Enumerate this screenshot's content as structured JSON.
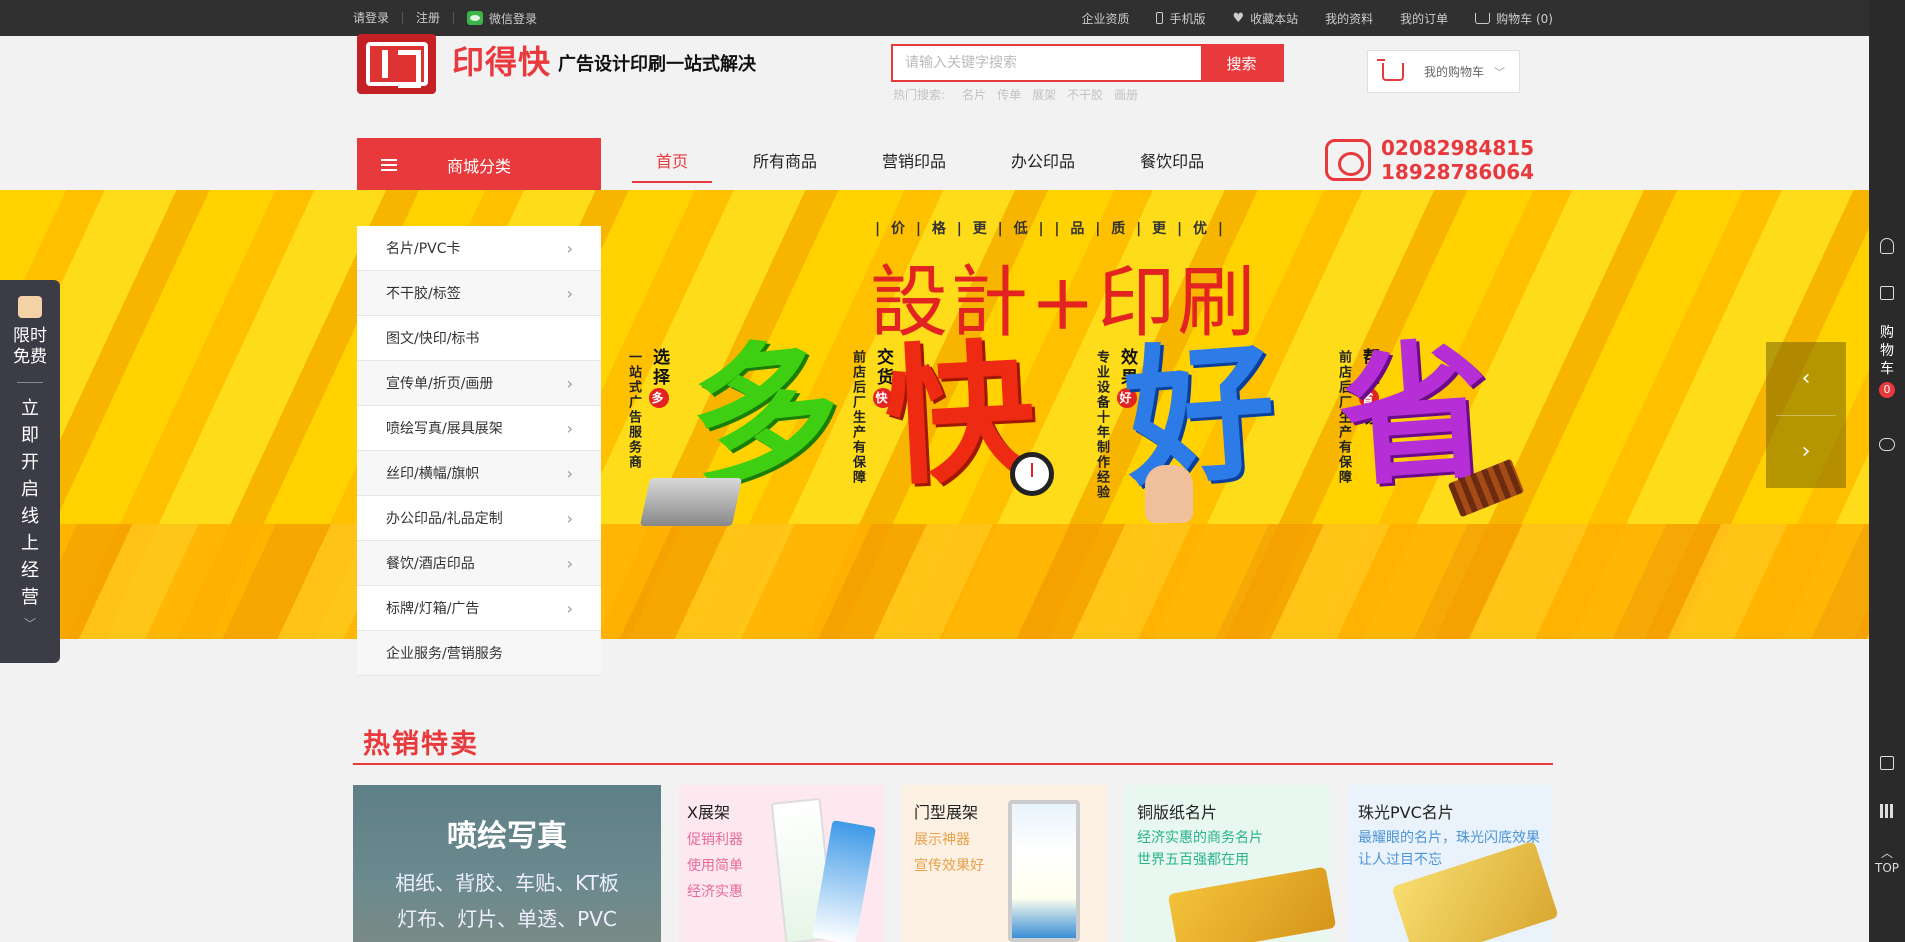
{
  "topbar": {
    "login": "请登录",
    "register": "注册",
    "wechat_login": "微信登录",
    "enterprise": "企业资质",
    "mobile": "手机版",
    "favorite": "收藏本站",
    "my_profile": "我的资料",
    "my_orders": "我的订单",
    "cart": "购物车 (0)"
  },
  "header": {
    "brand": "印得快",
    "slogan": "广告设计印刷一站式解决",
    "search_placeholder": "请输入关键字搜索",
    "search_button": "搜索",
    "hot_label": "热门搜索:",
    "hot_terms": [
      "名片",
      "传单",
      "展架",
      "不干胶",
      "画册"
    ],
    "cart_label": "我的购物车"
  },
  "nav": {
    "category_button": "商城分类",
    "items": [
      "首页",
      "所有商品",
      "营销印品",
      "办公印品",
      "餐饮印品"
    ],
    "active_index": 0,
    "phone1": "02082984815",
    "phone2": "18928786064"
  },
  "categories": [
    {
      "label": "名片/PVC卡",
      "has_sub": true
    },
    {
      "label": "不干胶/标签",
      "has_sub": true
    },
    {
      "label": "图文/快印/标书",
      "has_sub": false
    },
    {
      "label": "宣传单/折页/画册",
      "has_sub": true
    },
    {
      "label": "喷绘写真/展具展架",
      "has_sub": true
    },
    {
      "label": "丝印/横幅/旗帜",
      "has_sub": true
    },
    {
      "label": "办公印品/礼品定制",
      "has_sub": true
    },
    {
      "label": "餐饮/酒店印品",
      "has_sub": true
    },
    {
      "label": "标牌/灯箱/广告",
      "has_sub": true
    },
    {
      "label": "企业服务/营销服务",
      "has_sub": false
    }
  ],
  "banner": {
    "tagline": "| 价 | 格 | 更 | 低 |    | 品 | 质 | 更 | 优 |",
    "headline": "設計+印刷",
    "big_chars": [
      "多",
      "快",
      "好",
      "省"
    ],
    "blocks": [
      {
        "title_a": "选择",
        "badge": "多",
        "desc": "一站式广告服务商"
      },
      {
        "title_a": "交货",
        "badge": "快",
        "desc": "前店后厂生产有保障"
      },
      {
        "title_a": "效果",
        "badge": "好",
        "desc": "专业设备十年制作经验"
      },
      {
        "title_a": "帮您",
        "badge": "省",
        "title_b": "钱",
        "desc": "前店后厂生产有保障"
      }
    ]
  },
  "float_left": {
    "line1": "限时免费",
    "line2": "立即开启线上经营"
  },
  "right_bar": {
    "cart_text": "购物车",
    "cart_count": "0",
    "top": "TOP"
  },
  "hot_sale": {
    "title": "热销特卖",
    "main_card": {
      "title": "喷绘写真",
      "line1": "相纸、背胶、车贴、KT板",
      "line2": "灯布、灯片、单透、PVC"
    },
    "cards": [
      {
        "title": "X展架",
        "descs": [
          "促销利器",
          "使用简单",
          "经济实惠"
        ]
      },
      {
        "title": "门型展架",
        "descs": [
          "展示神器",
          "宣传效果好"
        ]
      },
      {
        "title": "铜版纸名片",
        "descs": [
          "经济实惠的商务名片",
          "世界五百强都在用"
        ]
      },
      {
        "title": "珠光PVC名片",
        "descs": [
          "最耀眼的名片，珠光闪底效果",
          "让人过目不忘"
        ]
      }
    ]
  },
  "colors": {
    "accent": "#e8393d",
    "topbar": "#303030",
    "banner_yellow": "#ffd200"
  }
}
